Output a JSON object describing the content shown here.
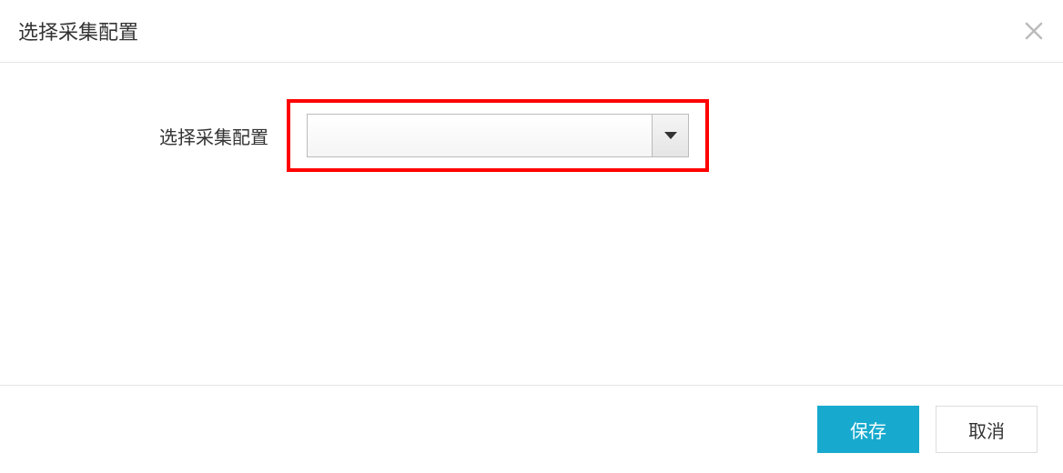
{
  "header": {
    "title": "选择采集配置"
  },
  "form": {
    "config_label": "选择采集配置",
    "config_value": ""
  },
  "footer": {
    "save_label": "保存",
    "cancel_label": "取消"
  }
}
